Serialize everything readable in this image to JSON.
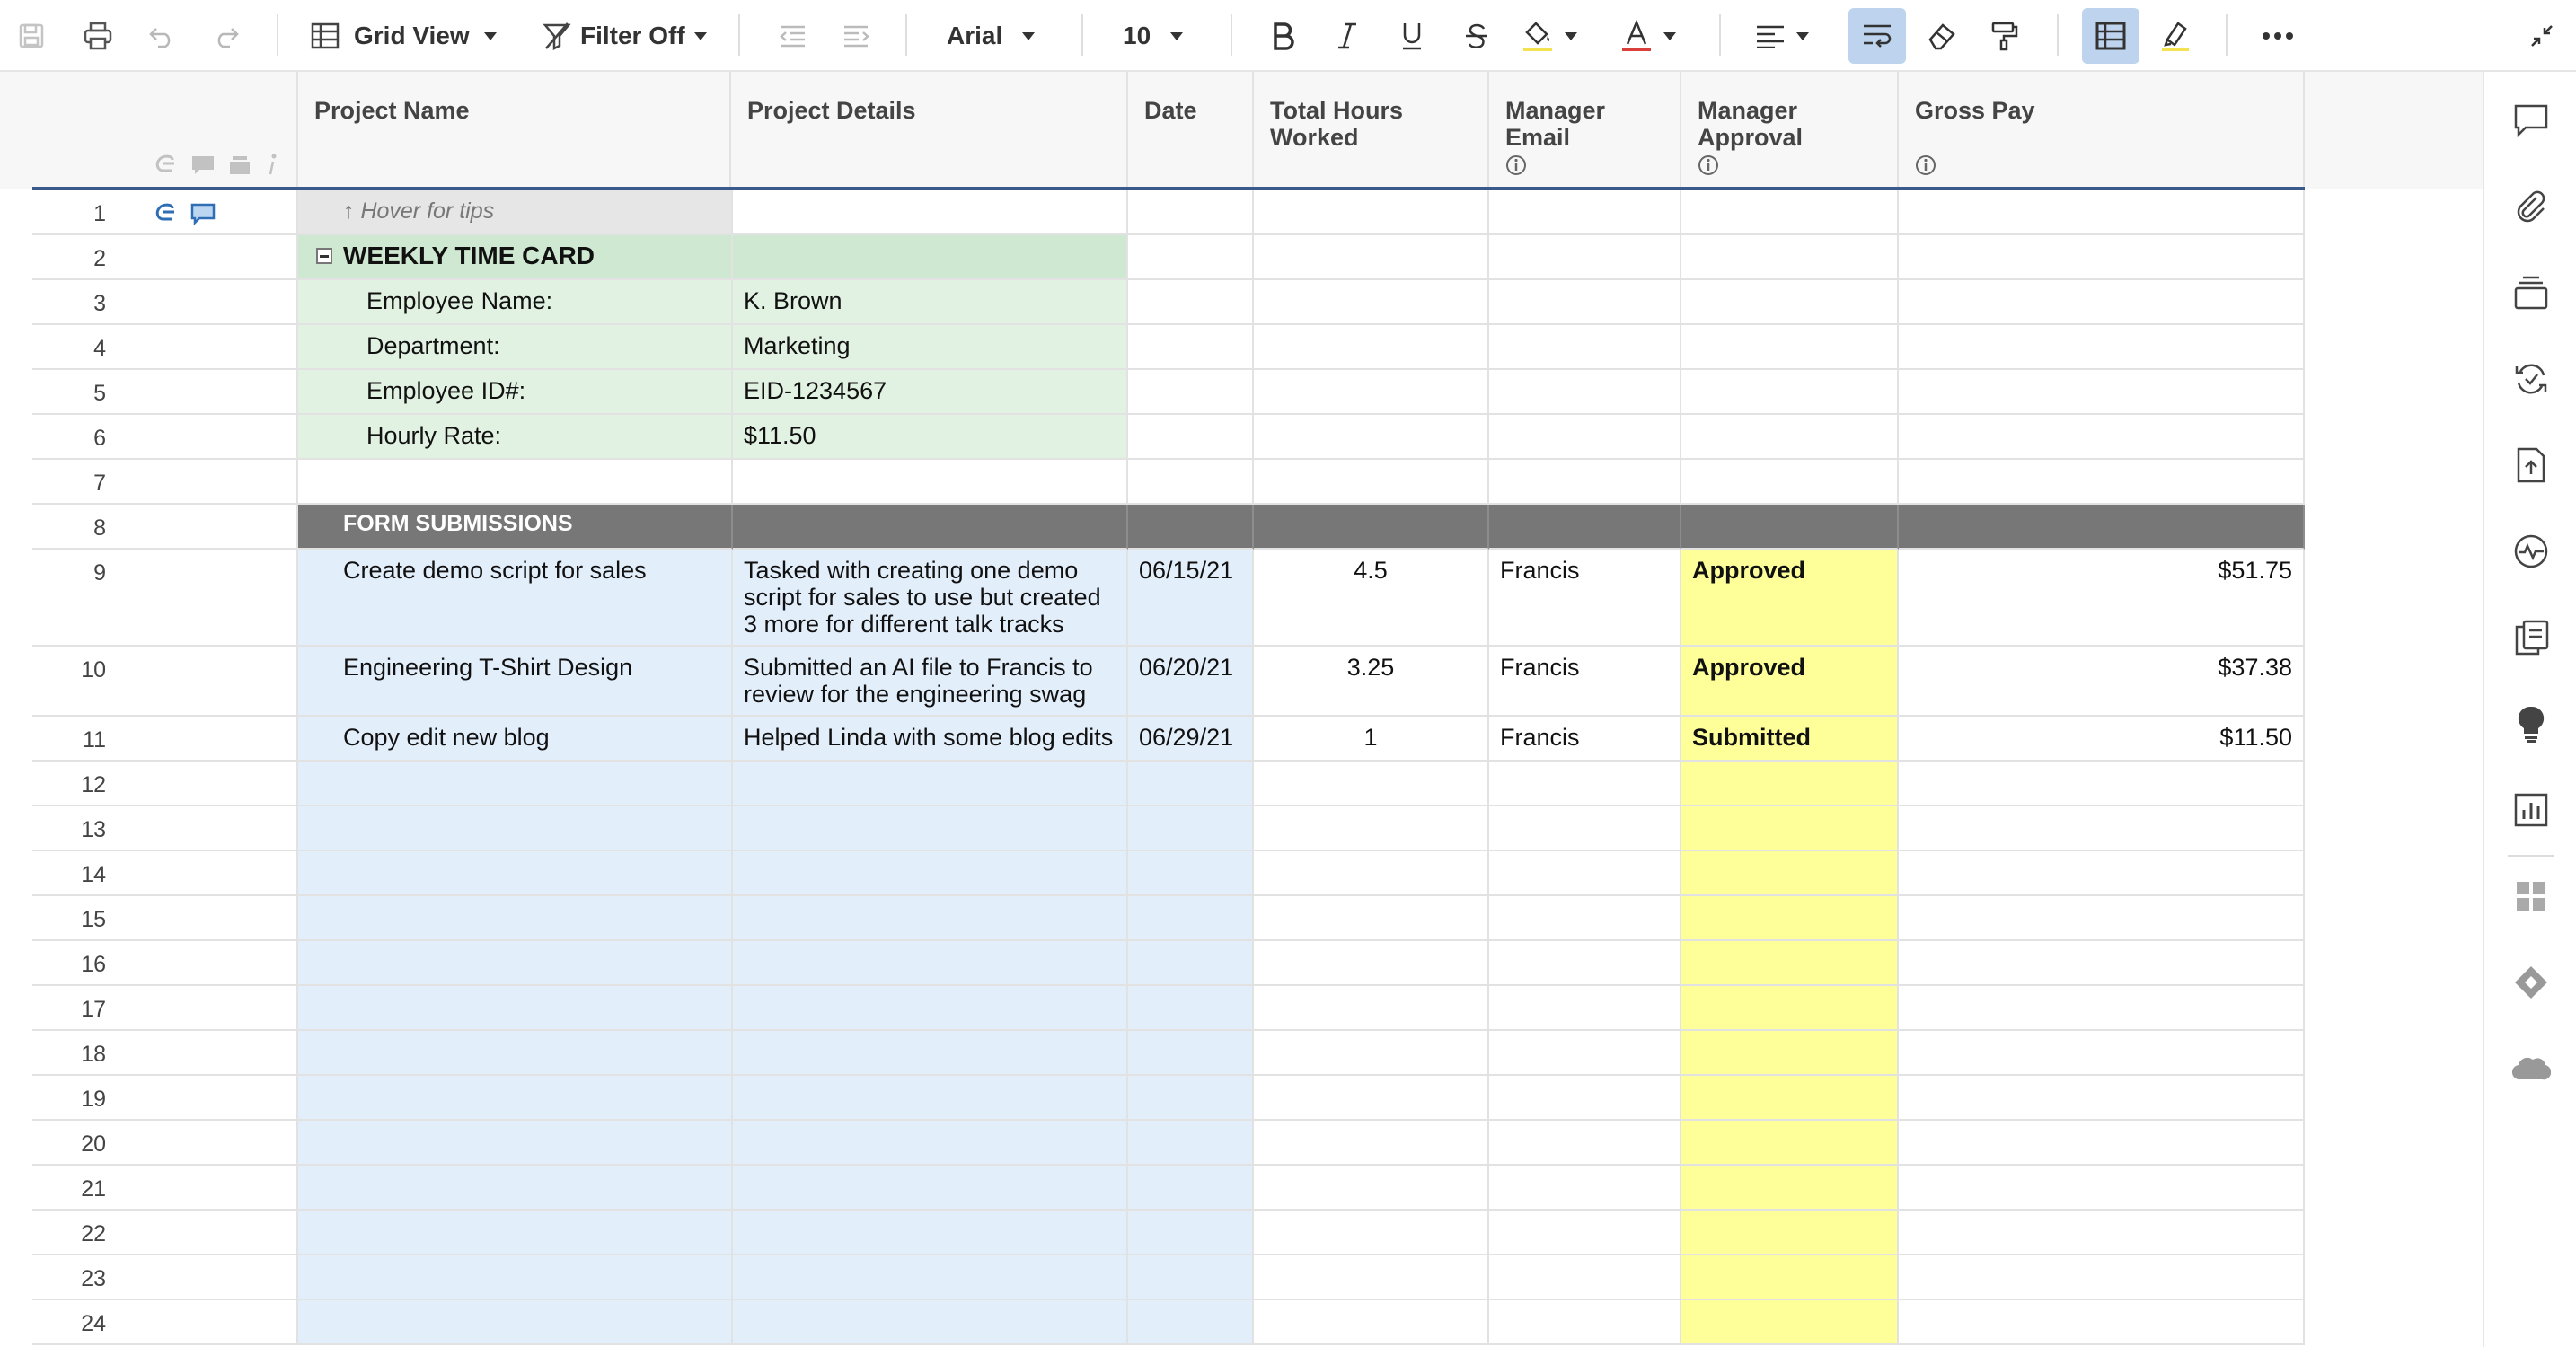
{
  "toolbar": {
    "view_label": "Grid View",
    "filter_label": "Filter Off",
    "font_name": "Arial",
    "font_size": "10"
  },
  "columns": [
    {
      "label": "Project Name",
      "info": false
    },
    {
      "label": "Project Details",
      "info": false
    },
    {
      "label": "Date",
      "info": false
    },
    {
      "label": "Total Hours Worked",
      "info": false
    },
    {
      "label": "Manager Email",
      "info": true
    },
    {
      "label": "Manager Approval",
      "info": true
    },
    {
      "label": "Gross Pay",
      "info": true
    }
  ],
  "rows": [
    {
      "num": "1",
      "cells": [
        "↑ Hover for tips",
        "",
        "",
        "",
        "",
        "",
        ""
      ]
    },
    {
      "num": "2",
      "cells": [
        "WEEKLY TIME CARD",
        "",
        "",
        "",
        "",
        "",
        ""
      ]
    },
    {
      "num": "3",
      "cells": [
        "Employee Name:",
        "K. Brown",
        "",
        "",
        "",
        "",
        ""
      ]
    },
    {
      "num": "4",
      "cells": [
        "Department:",
        "Marketing",
        "",
        "",
        "",
        "",
        ""
      ]
    },
    {
      "num": "5",
      "cells": [
        "Employee ID#:",
        "EID-1234567",
        "",
        "",
        "",
        "",
        ""
      ]
    },
    {
      "num": "6",
      "cells": [
        "Hourly Rate:",
        "$11.50",
        "",
        "",
        "",
        "",
        ""
      ]
    },
    {
      "num": "7",
      "cells": [
        "",
        "",
        "",
        "",
        "",
        "",
        ""
      ]
    },
    {
      "num": "8",
      "cells": [
        "FORM SUBMISSIONS",
        "",
        "",
        "",
        "",
        "",
        ""
      ]
    },
    {
      "num": "9",
      "cells": [
        "Create demo script for sales",
        "Tasked with creating one demo script for sales to use but created 3 more for different talk tracks",
        "06/15/21",
        "4.5",
        "Francis",
        "Approved",
        "$51.75"
      ]
    },
    {
      "num": "10",
      "cells": [
        "Engineering T-Shirt Design",
        "Submitted an AI file to Francis to review for the engineering swag",
        "06/20/21",
        "3.25",
        "Francis",
        "Approved",
        "$37.38"
      ]
    },
    {
      "num": "11",
      "cells": [
        "Copy edit new blog",
        "Helped Linda with some blog edits",
        "06/29/21",
        "1",
        "Francis",
        "Submitted",
        "$11.50"
      ]
    },
    {
      "num": "12",
      "cells": [
        "",
        "",
        "",
        "",
        "",
        "",
        ""
      ]
    },
    {
      "num": "13",
      "cells": [
        "",
        "",
        "",
        "",
        "",
        "",
        ""
      ]
    },
    {
      "num": "14",
      "cells": [
        "",
        "",
        "",
        "",
        "",
        "",
        ""
      ]
    },
    {
      "num": "15",
      "cells": [
        "",
        "",
        "",
        "",
        "",
        "",
        ""
      ]
    },
    {
      "num": "16",
      "cells": [
        "",
        "",
        "",
        "",
        "",
        "",
        ""
      ]
    },
    {
      "num": "17",
      "cells": [
        "",
        "",
        "",
        "",
        "",
        "",
        ""
      ]
    },
    {
      "num": "18",
      "cells": [
        "",
        "",
        "",
        "",
        "",
        "",
        ""
      ]
    },
    {
      "num": "19",
      "cells": [
        "",
        "",
        "",
        "",
        "",
        "",
        ""
      ]
    },
    {
      "num": "20",
      "cells": [
        "",
        "",
        "",
        "",
        "",
        "",
        ""
      ]
    },
    {
      "num": "21",
      "cells": [
        "",
        "",
        "",
        "",
        "",
        "",
        ""
      ]
    },
    {
      "num": "22",
      "cells": [
        "",
        "",
        "",
        "",
        "",
        "",
        ""
      ]
    },
    {
      "num": "23",
      "cells": [
        "",
        "",
        "",
        "",
        "",
        "",
        ""
      ]
    },
    {
      "num": "24",
      "cells": [
        "",
        "",
        "",
        "",
        "",
        "",
        ""
      ]
    }
  ],
  "colors": {
    "accent": "#3b5a8c",
    "blue_cell": "#e3eefb",
    "yellow_cell": "#ffff99",
    "green_cell": "#e2f2e2",
    "section_dark": "#777777"
  }
}
